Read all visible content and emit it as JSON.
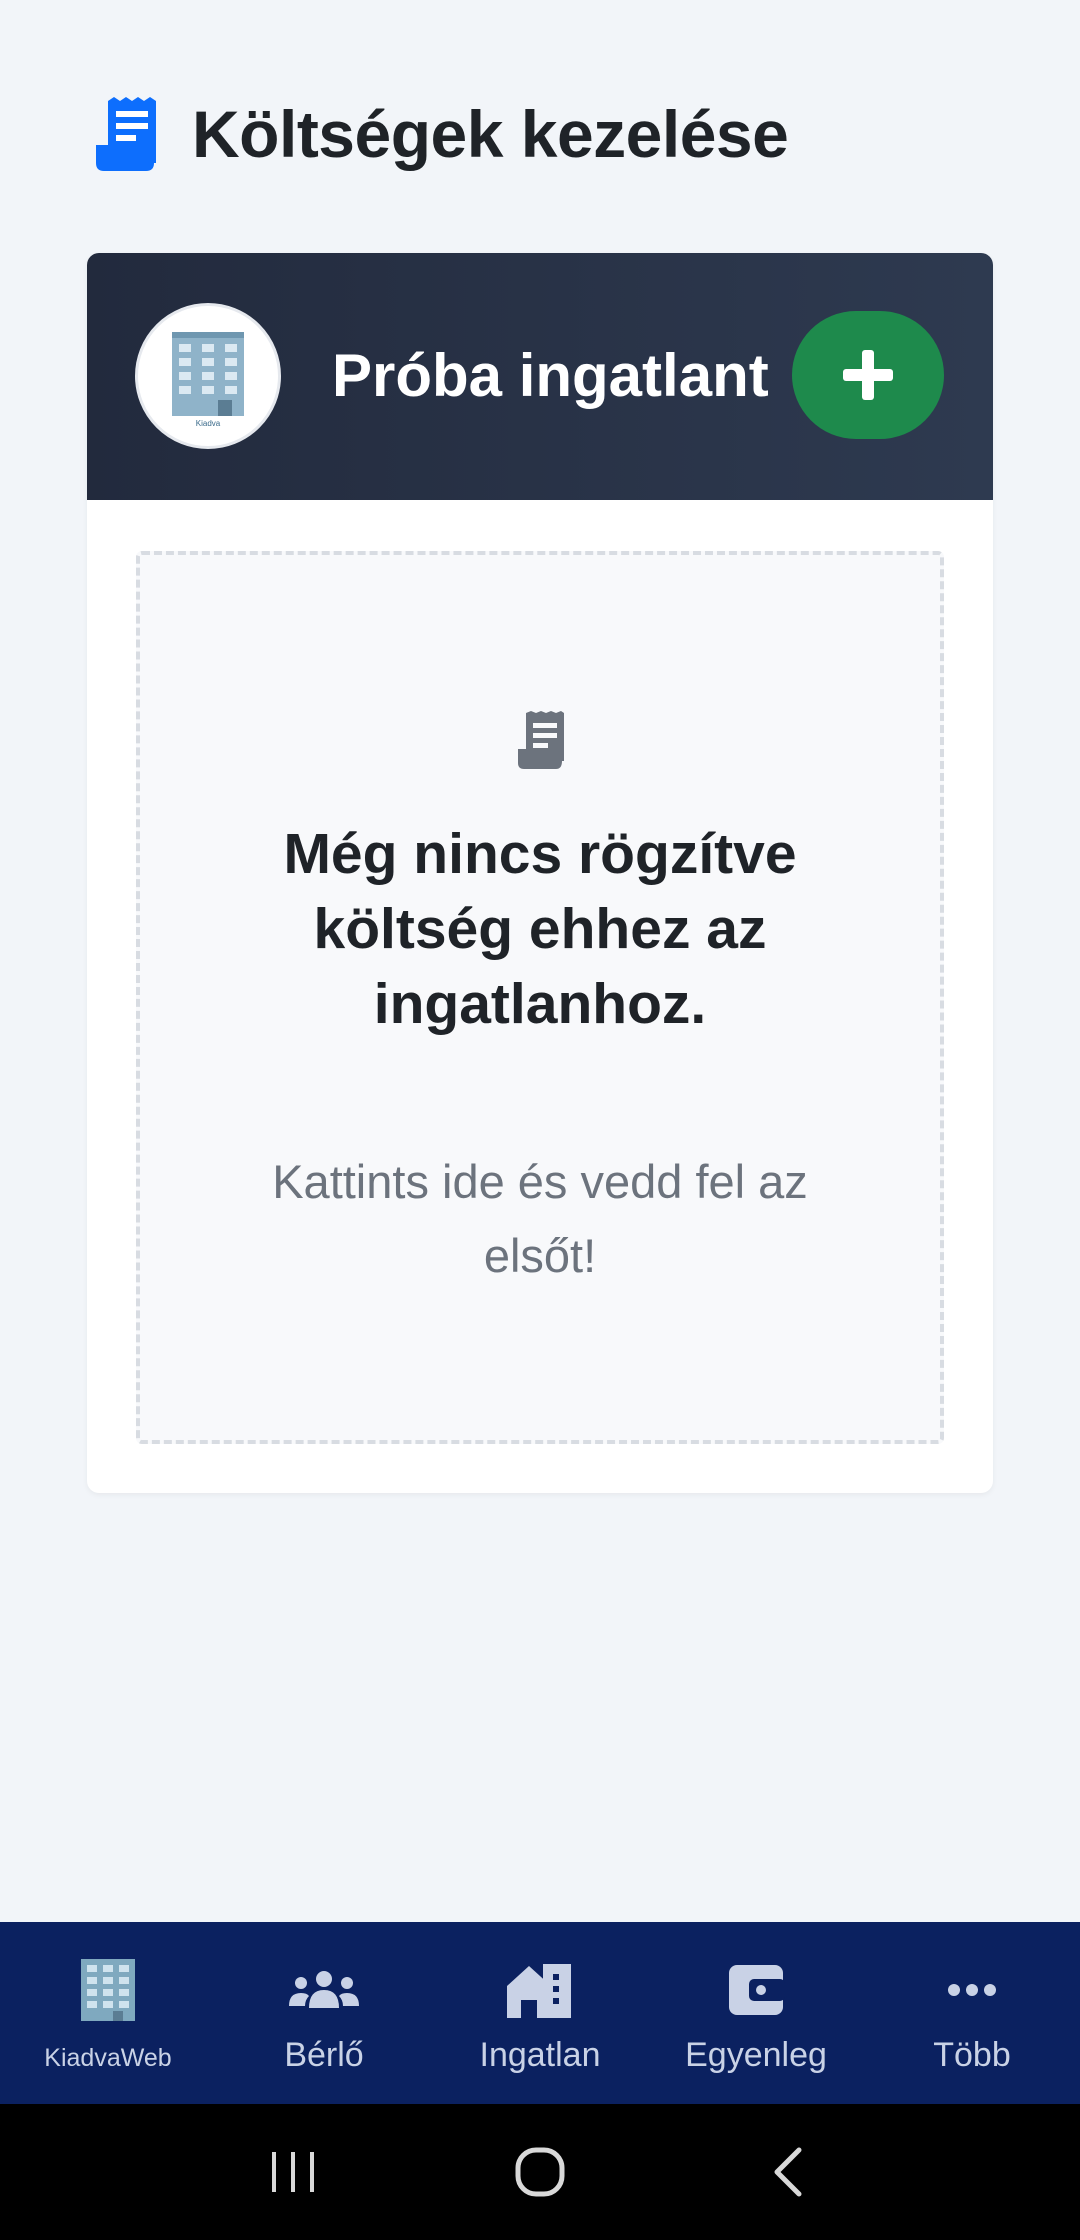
{
  "page": {
    "title": "Költségek kezelése",
    "title_icon": "receipt-icon"
  },
  "property": {
    "name": "Próba ingatlant",
    "avatar_caption": "Kiadva",
    "add_button_icon": "plus-icon"
  },
  "empty_state": {
    "icon": "receipt-icon",
    "title": "Még nincs rögzítve költség ehhez az ingatlanhoz.",
    "subtitle": "Kattints ide és vedd fel az elsőt!"
  },
  "bottom_nav": {
    "items": [
      {
        "label": "KiadvaWeb",
        "icon": "building-logo-icon"
      },
      {
        "label": "Bérlő",
        "icon": "users-icon"
      },
      {
        "label": "Ingatlan",
        "icon": "house-icon"
      },
      {
        "label": "Egyenleg",
        "icon": "wallet-icon"
      },
      {
        "label": "Több",
        "icon": "ellipsis-icon"
      }
    ]
  },
  "system_nav": {
    "items": [
      "recent-apps-icon",
      "home-icon",
      "back-icon"
    ]
  },
  "colors": {
    "background": "#f2f5f9",
    "card_header": "#222a3d",
    "add_button": "#1e8a4c",
    "accent_blue": "#0d6efd",
    "nav_background": "#0b2160"
  }
}
